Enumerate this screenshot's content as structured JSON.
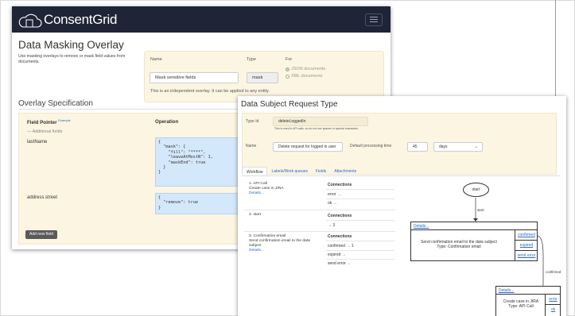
{
  "app": {
    "brand": "ConsentGrid"
  },
  "masking": {
    "title": "Data Masking Overlay",
    "description": "Use masking overlays to remove or mask field values from documents.",
    "name_label": "Name",
    "name_value": "Mask sensitive fields",
    "type_label": "Type",
    "type_value": "mask",
    "for_label": "For",
    "for_options": [
      "JSON documents",
      "XML documents"
    ],
    "note": "This is an independent overlay. It can be applied to any entity."
  },
  "spec": {
    "title": "Overlay Specification",
    "col_pointer": "Field Pointer",
    "col_example": "Example",
    "col_operation": "Operation",
    "additional": "— Additional fields",
    "rows": [
      {
        "field": "lastName",
        "code": "{\n  \"mask\": {\n    \"fill\": \"****\",\n    \"leaveAtMostN\": 1,\n    \"maskEnd\": true\n  }\n}"
      },
      {
        "field": "address.street",
        "code": "{\n  \"remove\": true\n}"
      }
    ],
    "add_button": "Add new field"
  },
  "dsr": {
    "title": "Data Subject Request Type",
    "typeid_label": "Type Id",
    "typeid_value": "deleteLoggedIn",
    "typeid_help": "This is used in API calls, so do not use spaces or special characters.",
    "name_label": "Name",
    "name_value": "Delete request for logged in user",
    "time_label": "Default processing time",
    "time_value": "45",
    "unit_value": "days",
    "tabs": [
      "Workflow",
      "Labels/Work queues",
      "Fields",
      "Attachments"
    ],
    "steps": [
      {
        "title": "1. API Call",
        "desc": "Create case in JIRA",
        "link": "Details...",
        "conn_header": "Connections",
        "connections": [
          "error →",
          "ok →"
        ]
      },
      {
        "title": "2. start",
        "desc": "",
        "link": "",
        "conn_header": "Connections",
        "connections": [
          "→ 3"
        ]
      },
      {
        "title": "3. Confirmation email",
        "desc": "Send confirmation email to the data subject",
        "link": "Details...",
        "conn_header": "Connections",
        "connections": [
          "confirmed → 1",
          "expired →",
          "send error →"
        ]
      }
    ]
  },
  "diagram": {
    "start": "start",
    "edge_start": "start",
    "edge_confirmed": "confirmed",
    "node1": {
      "details": "Details...",
      "text": "Send confirmation email to the data subject",
      "type": "Type: Confirmation email",
      "outs": [
        "confirmed",
        "expired",
        "send error"
      ]
    },
    "node2": {
      "details": "Details...",
      "text": "Create case in JIRA",
      "type": "Type: API Call",
      "outs": [
        "error",
        "ok"
      ]
    }
  }
}
